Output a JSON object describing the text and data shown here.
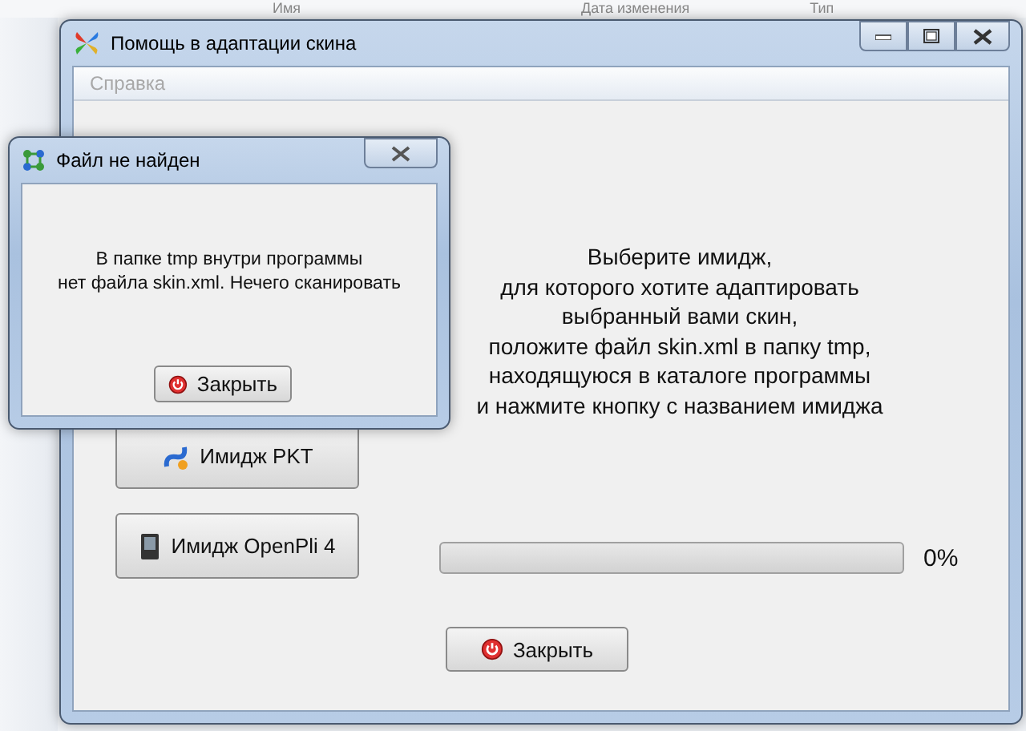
{
  "background_window": {
    "columns": [
      "Имя",
      "Дата изменения",
      "Тип"
    ]
  },
  "main_window": {
    "title": "Помощь в адаптации скина",
    "menu": [
      {
        "label": "Справка",
        "disabled": true
      }
    ],
    "instructions": [
      "Выберите имидж,",
      "для которого хотите адаптировать",
      "выбранный вами скин,",
      "положите файл skin.xml в папку tmp,",
      "находящуюся в каталоге программы",
      "и нажмите кнопку с названием имиджа"
    ],
    "image_buttons": [
      "Имидж PKT",
      "Имидж OpenPli 4"
    ],
    "progress": {
      "level": 0,
      "reading": "0%"
    },
    "close_button": "Закрыть"
  },
  "dialog": {
    "title": "Файл не найден",
    "message": [
      "В папке tmp внутри программы",
      "нет файла skin.xml. Нечего сканировать"
    ],
    "close_button": "Закрыть"
  }
}
